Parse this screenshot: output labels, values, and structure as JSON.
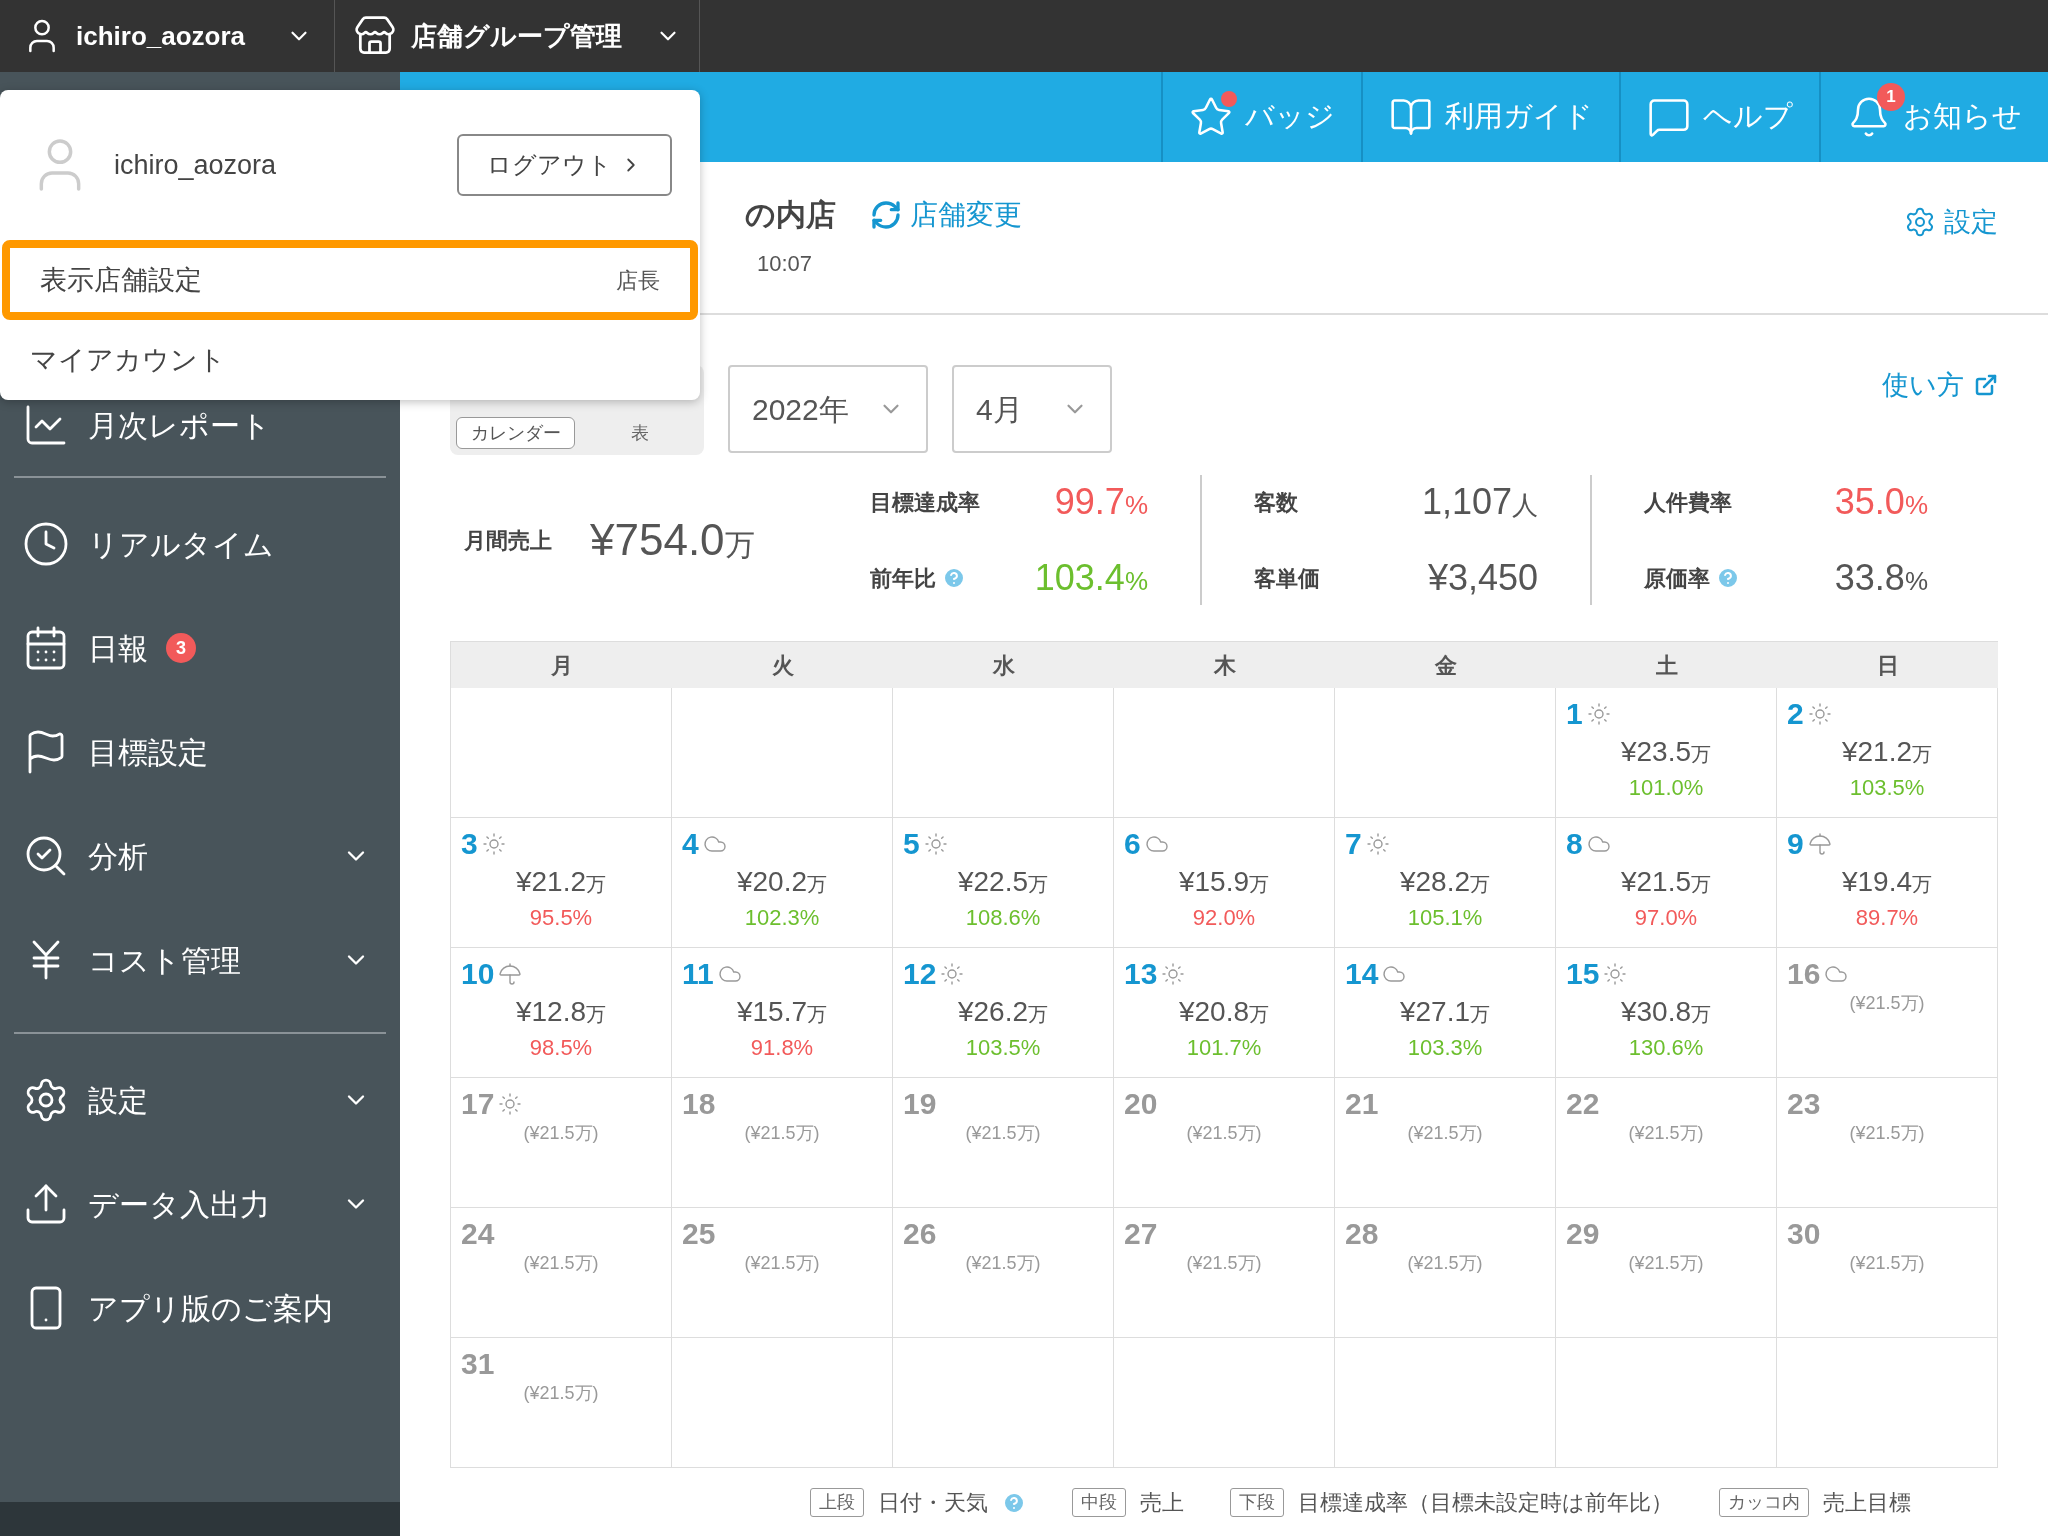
{
  "top_bar": {
    "user": "ichiro_aozora",
    "group": "店舗グループ管理"
  },
  "nav": [
    {
      "kind": "badge",
      "label": "バッジ",
      "dot": true
    },
    {
      "kind": "guide",
      "label": "利用ガイド"
    },
    {
      "kind": "help",
      "label": "ヘルプ"
    },
    {
      "kind": "bell",
      "label": "お知らせ",
      "count": "1"
    }
  ],
  "user_menu": {
    "name": "ichiro_aozora",
    "logout": "ログアウト",
    "items": [
      {
        "label": "表示店舗設定",
        "role": "店長",
        "selected": true
      },
      {
        "label": "マイアカウント",
        "selected": false
      }
    ]
  },
  "sidebar": {
    "sections": [
      [
        {
          "label": "月次レポート"
        }
      ],
      [
        {
          "label": "リアルタイム"
        },
        {
          "label": "日報",
          "badge": "3"
        },
        {
          "label": "目標設定"
        },
        {
          "label": "分析",
          "expandable": true
        },
        {
          "label": "コスト管理",
          "expandable": true
        }
      ],
      [
        {
          "label": "設定",
          "expandable": true
        },
        {
          "label": "データ入出力",
          "expandable": true
        },
        {
          "label": "アプリ版のご案内"
        }
      ]
    ]
  },
  "header": {
    "store": "の内店",
    "change_store": "店舗変更",
    "updated": "10:07",
    "settings": "設定"
  },
  "controls": {
    "views": [
      {
        "label": "カレンダー",
        "selected": true
      },
      {
        "label": "表",
        "selected": false
      }
    ],
    "year": "2022年",
    "month": "4月",
    "howto": "使い方"
  },
  "summary": {
    "label": "月間売上",
    "value": "¥754.0",
    "unit": "万"
  },
  "metrics": [
    [
      {
        "label": "目標達成率",
        "value": "99.7",
        "unit": "%",
        "color": "#f25a5a"
      },
      {
        "label": "前年比",
        "help": true,
        "value": "103.4",
        "unit": "%",
        "color": "#6cbf2e"
      }
    ],
    [
      {
        "label": "客数",
        "value": "1,107",
        "unit": "人",
        "color": "#555555"
      },
      {
        "label": "客単価",
        "value": "¥3,450",
        "color": "#555555"
      }
    ],
    [
      {
        "label": "人件費率",
        "value": "35.0",
        "unit": "%",
        "color": "#f25a5a"
      },
      {
        "label": "原価率",
        "help": true,
        "value": "33.8",
        "unit": "%",
        "color": "#555555"
      }
    ]
  ],
  "calendar": {
    "weekdays": [
      "月",
      "火",
      "水",
      "木",
      "金",
      "土",
      "日"
    ],
    "weeks": [
      [
        {
          "kind": "empty"
        },
        {
          "kind": "empty"
        },
        {
          "kind": "empty"
        },
        {
          "kind": "empty"
        },
        {
          "kind": "empty"
        },
        {
          "kind": "actual",
          "day": "1",
          "weather": {
            "kind": "sunny"
          },
          "sales": "¥23.5",
          "unit": "万",
          "rate": "101.0%",
          "color": "#6cbf2e"
        },
        {
          "kind": "actual",
          "day": "2",
          "weather": {
            "kind": "sunny"
          },
          "sales": "¥21.2",
          "unit": "万",
          "rate": "103.5%",
          "color": "#6cbf2e"
        }
      ],
      [
        {
          "kind": "actual",
          "day": "3",
          "weather": {
            "kind": "sunny"
          },
          "sales": "¥21.2",
          "unit": "万",
          "rate": "95.5%",
          "color": "#f25a5a"
        },
        {
          "kind": "actual",
          "day": "4",
          "weather": {
            "kind": "cloudy"
          },
          "sales": "¥20.2",
          "unit": "万",
          "rate": "102.3%",
          "color": "#6cbf2e"
        },
        {
          "kind": "actual",
          "day": "5",
          "weather": {
            "kind": "sunny"
          },
          "sales": "¥22.5",
          "unit": "万",
          "rate": "108.6%",
          "color": "#6cbf2e"
        },
        {
          "kind": "actual",
          "day": "6",
          "weather": {
            "kind": "cloudy"
          },
          "sales": "¥15.9",
          "unit": "万",
          "rate": "92.0%",
          "color": "#f25a5a"
        },
        {
          "kind": "actual",
          "day": "7",
          "weather": {
            "kind": "sunny"
          },
          "sales": "¥28.2",
          "unit": "万",
          "rate": "105.1%",
          "color": "#6cbf2e"
        },
        {
          "kind": "actual",
          "day": "8",
          "weather": {
            "kind": "cloudy"
          },
          "sales": "¥21.5",
          "unit": "万",
          "rate": "97.0%",
          "color": "#f25a5a"
        },
        {
          "kind": "actual",
          "day": "9",
          "weather": {
            "kind": "rainy"
          },
          "sales": "¥19.4",
          "unit": "万",
          "rate": "89.7%",
          "color": "#f25a5a"
        }
      ],
      [
        {
          "kind": "actual",
          "day": "10",
          "weather": {
            "kind": "rainy"
          },
          "sales": "¥12.8",
          "unit": "万",
          "rate": "98.5%",
          "color": "#f25a5a"
        },
        {
          "kind": "actual",
          "day": "11",
          "weather": {
            "kind": "cloudy"
          },
          "sales": "¥15.7",
          "unit": "万",
          "rate": "91.8%",
          "color": "#f25a5a"
        },
        {
          "kind": "actual",
          "day": "12",
          "weather": {
            "kind": "sunny"
          },
          "sales": "¥26.2",
          "unit": "万",
          "rate": "103.5%",
          "color": "#6cbf2e"
        },
        {
          "kind": "actual",
          "day": "13",
          "weather": {
            "kind": "sunny"
          },
          "sales": "¥20.8",
          "unit": "万",
          "rate": "101.7%",
          "color": "#6cbf2e"
        },
        {
          "kind": "actual",
          "day": "14",
          "weather": {
            "kind": "cloudy"
          },
          "sales": "¥27.1",
          "unit": "万",
          "rate": "103.3%",
          "color": "#6cbf2e"
        },
        {
          "kind": "actual",
          "day": "15",
          "weather": {
            "kind": "sunny"
          },
          "sales": "¥30.8",
          "unit": "万",
          "rate": "130.6%",
          "color": "#6cbf2e"
        },
        {
          "kind": "forecast",
          "day": "16",
          "weather": {
            "kind": "cloudy"
          },
          "target": "(¥21.5万)"
        }
      ],
      [
        {
          "kind": "forecast",
          "day": "17",
          "weather": {
            "kind": "sunny"
          },
          "target": "(¥21.5万)"
        },
        {
          "kind": "forecast",
          "day": "18",
          "target": "(¥21.5万)"
        },
        {
          "kind": "forecast",
          "day": "19",
          "target": "(¥21.5万)"
        },
        {
          "kind": "forecast",
          "day": "20",
          "target": "(¥21.5万)"
        },
        {
          "kind": "forecast",
          "day": "21",
          "target": "(¥21.5万)"
        },
        {
          "kind": "forecast",
          "day": "22",
          "target": "(¥21.5万)"
        },
        {
          "kind": "forecast",
          "day": "23",
          "target": "(¥21.5万)"
        }
      ],
      [
        {
          "kind": "forecast",
          "day": "24",
          "target": "(¥21.5万)"
        },
        {
          "kind": "forecast",
          "day": "25",
          "target": "(¥21.5万)"
        },
        {
          "kind": "forecast",
          "day": "26",
          "target": "(¥21.5万)"
        },
        {
          "kind": "forecast",
          "day": "27",
          "target": "(¥21.5万)"
        },
        {
          "kind": "forecast",
          "day": "28",
          "target": "(¥21.5万)"
        },
        {
          "kind": "forecast",
          "day": "29",
          "target": "(¥21.5万)"
        },
        {
          "kind": "forecast",
          "day": "30",
          "target": "(¥21.5万)"
        }
      ],
      [
        {
          "kind": "forecast",
          "day": "31",
          "target": "(¥21.5万)"
        },
        {
          "kind": "empty"
        },
        {
          "kind": "empty"
        },
        {
          "kind": "empty"
        },
        {
          "kind": "empty"
        },
        {
          "kind": "empty"
        },
        {
          "kind": "empty"
        }
      ]
    ]
  },
  "legend": [
    {
      "tag": "上段",
      "text": "日付・天気",
      "help": true
    },
    {
      "tag": "中段",
      "text": "売上"
    },
    {
      "tag": "下段",
      "text": "目標達成率（目標未設定時は前年比）"
    },
    {
      "tag": "カッコ内",
      "text": "売上目標"
    }
  ]
}
